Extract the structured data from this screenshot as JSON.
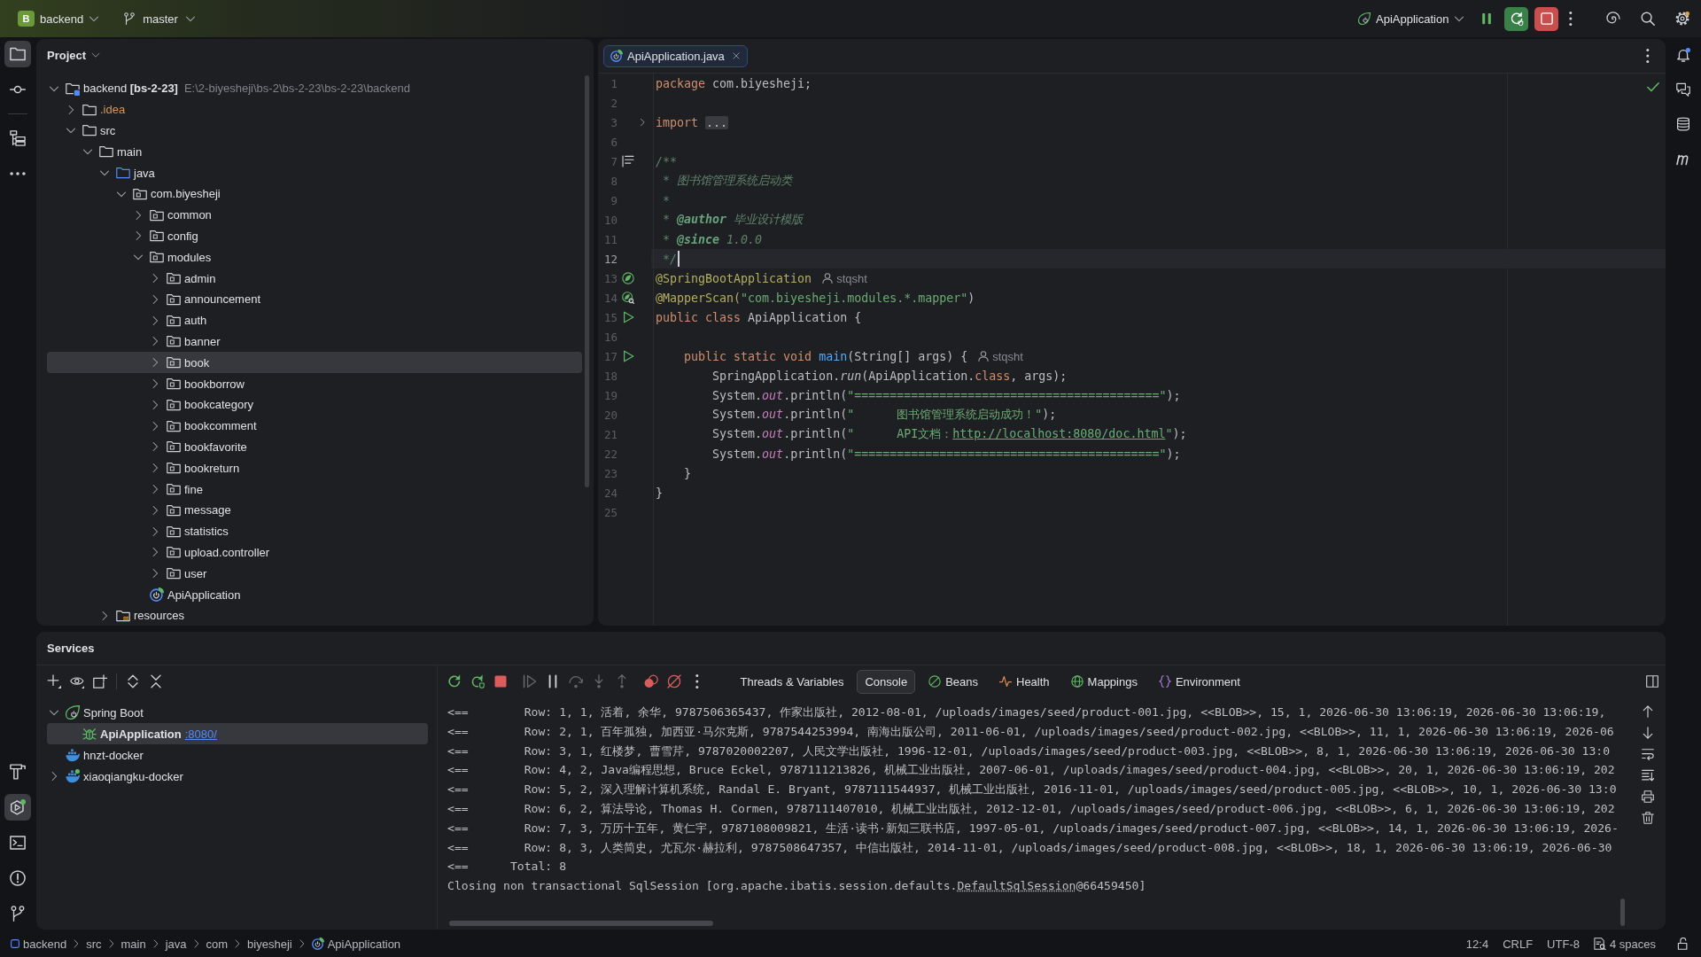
{
  "title_bar": {
    "project_badge": "B",
    "project": "backend",
    "branch": "master",
    "run_config": "ApiApplication"
  },
  "left_stripe": {
    "top": [
      {
        "kind": "project",
        "selected": true
      },
      {
        "kind": "commit",
        "selected": false
      },
      {
        "kind": "structure",
        "selected": false
      },
      {
        "kind": "more",
        "selected": false
      }
    ],
    "bottom": [
      {
        "kind": "build",
        "selected": false
      },
      {
        "kind": "services",
        "selected": true
      },
      {
        "kind": "terminal",
        "selected": false
      },
      {
        "kind": "problems",
        "selected": false
      },
      {
        "kind": "git",
        "selected": false
      }
    ]
  },
  "project": {
    "title": "Project",
    "tree": [
      {
        "label": "backend **[bs-2-23]**",
        "location": "E:\\2-biyesheji\\bs-2\\bs-2-23\\bs-2-23\\backend",
        "kind": "module",
        "expanded": true,
        "selected": false,
        "children": [
          {
            "label": ".idea",
            "kind": "ignored",
            "expanded": false,
            "selected": false
          },
          {
            "label": "src",
            "kind": "folder",
            "expanded": true,
            "selected": false,
            "children": [
              {
                "label": "main",
                "kind": "folder",
                "expanded": true,
                "selected": false,
                "children": [
                  {
                    "label": "java",
                    "kind": "sources",
                    "expanded": true,
                    "selected": false,
                    "children": [
                      {
                        "label": "com.biyesheji",
                        "kind": "package",
                        "expanded": true,
                        "selected": false,
                        "children": [
                          {
                            "label": "common",
                            "kind": "package",
                            "expanded": false,
                            "selected": false
                          },
                          {
                            "label": "config",
                            "kind": "package",
                            "expanded": false,
                            "selected": false
                          },
                          {
                            "label": "modules",
                            "kind": "package",
                            "expanded": true,
                            "selected": false,
                            "children": [
                              {
                                "label": "admin",
                                "kind": "package",
                                "expanded": false,
                                "selected": false
                              },
                              {
                                "label": "announcement",
                                "kind": "package",
                                "expanded": false,
                                "selected": false
                              },
                              {
                                "label": "auth",
                                "kind": "package",
                                "expanded": false,
                                "selected": false
                              },
                              {
                                "label": "banner",
                                "kind": "package",
                                "expanded": false,
                                "selected": false
                              },
                              {
                                "label": "book",
                                "kind": "package",
                                "expanded": false,
                                "selected": true
                              },
                              {
                                "label": "bookborrow",
                                "kind": "package",
                                "expanded": false,
                                "selected": false
                              },
                              {
                                "label": "bookcategory",
                                "kind": "package",
                                "expanded": false,
                                "selected": false
                              },
                              {
                                "label": "bookcomment",
                                "kind": "package",
                                "expanded": false,
                                "selected": false
                              },
                              {
                                "label": "bookfavorite",
                                "kind": "package",
                                "expanded": false,
                                "selected": false
                              },
                              {
                                "label": "bookreturn",
                                "kind": "package",
                                "expanded": false,
                                "selected": false
                              },
                              {
                                "label": "fine",
                                "kind": "package",
                                "expanded": false,
                                "selected": false
                              },
                              {
                                "label": "message",
                                "kind": "package",
                                "expanded": false,
                                "selected": false
                              },
                              {
                                "label": "statistics",
                                "kind": "package",
                                "expanded": false,
                                "selected": false
                              },
                              {
                                "label": "upload.controller",
                                "kind": "package",
                                "expanded": false,
                                "selected": false
                              },
                              {
                                "label": "user",
                                "kind": "package",
                                "expanded": false,
                                "selected": false
                              }
                            ]
                          },
                          {
                            "label": "ApiApplication",
                            "kind": "class",
                            "selected": false
                          }
                        ]
                      }
                    ]
                  },
                  {
                    "label": "resources",
                    "kind": "resources",
                    "expanded": false,
                    "selected": false
                  }
                ]
              }
            ]
          }
        ]
      }
    ]
  },
  "editor": {
    "tabs": [
      {
        "label": "ApiApplication.java",
        "selected": true
      }
    ],
    "lines": [
      {
        "number": "1",
        "current": false,
        "tokens": [
          {
            "kind": "keyword",
            "text": "package"
          },
          {
            "kind": "plain",
            "text": " com.biyesheji;"
          }
        ]
      },
      {
        "number": "2",
        "current": false
      },
      {
        "number": "3",
        "current": false,
        "gutter": {
          "kind": "fold"
        },
        "tokens": [
          {
            "kind": "keyword",
            "text": "import "
          },
          {
            "kind": "folded",
            "text": "..."
          }
        ]
      },
      {
        "number": "6",
        "current": false
      },
      {
        "number": "7",
        "current": false,
        "gutter": {
          "kind": "doc"
        },
        "tokens": [
          {
            "kind": "doc",
            "text": "/**"
          }
        ]
      },
      {
        "number": "8",
        "current": false,
        "tokens": [
          {
            "kind": "doc",
            "text": " * 图书馆管理系统启动类"
          }
        ]
      },
      {
        "number": "9",
        "current": false,
        "tokens": [
          {
            "kind": "doc",
            "text": " *"
          }
        ]
      },
      {
        "number": "10",
        "current": false,
        "tokens": [
          {
            "kind": "doc",
            "text": " * "
          },
          {
            "kind": "doctag",
            "text": "@author"
          },
          {
            "kind": "doc",
            "text": " 毕业设计模版"
          }
        ]
      },
      {
        "number": "11",
        "current": false,
        "tokens": [
          {
            "kind": "doc",
            "text": " * "
          },
          {
            "kind": "doctag",
            "text": "@since"
          },
          {
            "kind": "doc",
            "text": " 1.0.0"
          }
        ]
      },
      {
        "number": "12",
        "current": true,
        "tokens": [
          {
            "kind": "doc",
            "text": " */"
          }
        ]
      },
      {
        "number": "13",
        "current": false,
        "gutter": {
          "kind": "bean"
        },
        "author": "stqsht",
        "tokens": [
          {
            "kind": "annotation",
            "text": "@SpringBootApplication"
          }
        ]
      },
      {
        "number": "14",
        "current": false,
        "gutter": {
          "kind": "mapper"
        },
        "tokens": [
          {
            "kind": "annotation",
            "text": "@MapperScan("
          },
          {
            "kind": "string",
            "text": "\"com.biyesheji.modules.*.mapper\""
          },
          {
            "kind": "plain",
            "text": ")"
          }
        ]
      },
      {
        "number": "15",
        "current": false,
        "gutter": {
          "kind": "run"
        },
        "tokens": [
          {
            "kind": "keyword",
            "text": "public class"
          },
          {
            "kind": "plain",
            "text": " ApiApplication {"
          }
        ]
      },
      {
        "number": "16",
        "current": false
      },
      {
        "number": "17",
        "current": false,
        "gutter": {
          "kind": "run"
        },
        "author": "stqsht",
        "tokens": [
          {
            "kind": "keyword",
            "text": "    public static void "
          },
          {
            "kind": "method",
            "text": "main"
          },
          {
            "kind": "plain",
            "text": "(String[] args) {"
          }
        ]
      },
      {
        "number": "18",
        "current": false,
        "tokens": [
          {
            "kind": "plain",
            "text": "        SpringApplication."
          },
          {
            "kind": "static-call",
            "text": "run"
          },
          {
            "kind": "plain",
            "text": "(ApiApplication."
          },
          {
            "kind": "keyword",
            "text": "class"
          },
          {
            "kind": "plain",
            "text": ", args);"
          }
        ]
      },
      {
        "number": "19",
        "current": false,
        "tokens": [
          {
            "kind": "plain",
            "text": "        System."
          },
          {
            "kind": "static-field",
            "text": "out"
          },
          {
            "kind": "plain",
            "text": ".println("
          },
          {
            "kind": "string",
            "text": "\"===========================================\""
          },
          {
            "kind": "plain",
            "text": ");"
          }
        ]
      },
      {
        "number": "20",
        "current": false,
        "tokens": [
          {
            "kind": "plain",
            "text": "        System."
          },
          {
            "kind": "static-field",
            "text": "out"
          },
          {
            "kind": "plain",
            "text": ".println("
          },
          {
            "kind": "string",
            "text": "\"      图书馆管理系统启动成功！\""
          },
          {
            "kind": "plain",
            "text": ");"
          }
        ]
      },
      {
        "number": "21",
        "current": false,
        "tokens": [
          {
            "kind": "plain",
            "text": "        System."
          },
          {
            "kind": "static-field",
            "text": "out"
          },
          {
            "kind": "plain",
            "text": ".println("
          },
          {
            "kind": "string",
            "text": "\"      API文档："
          },
          {
            "kind": "link",
            "text": "http://localhost:8080/doc.html"
          },
          {
            "kind": "string",
            "text": "\""
          },
          {
            "kind": "plain",
            "text": ");"
          }
        ]
      },
      {
        "number": "22",
        "current": false,
        "tokens": [
          {
            "kind": "plain",
            "text": "        System."
          },
          {
            "kind": "static-field",
            "text": "out"
          },
          {
            "kind": "plain",
            "text": ".println("
          },
          {
            "kind": "string",
            "text": "\"===========================================\""
          },
          {
            "kind": "plain",
            "text": ");"
          }
        ]
      },
      {
        "number": "23",
        "current": false,
        "tokens": [
          {
            "kind": "plain",
            "text": "    }"
          }
        ]
      },
      {
        "number": "24",
        "current": false,
        "tokens": [
          {
            "kind": "plain",
            "text": "}"
          }
        ]
      },
      {
        "number": "25",
        "current": false
      }
    ]
  },
  "services": {
    "title": "Services",
    "tree": [
      {
        "label": "Spring Boot",
        "kind": "spring",
        "expanded": true,
        "selected": false,
        "running": false,
        "children": [
          {
            "label": "ApiApplication",
            "kind": "debug",
            "link": ":8080/",
            "selected": true,
            "running": false
          }
        ]
      },
      {
        "label": "hnzt-docker",
        "kind": "docker",
        "selected": false,
        "running": false
      },
      {
        "label": "xiaoqiangku-docker",
        "kind": "docker",
        "expanded": false,
        "selected": false,
        "running": true
      }
    ],
    "debug_toolbar": [
      {
        "kind": "rerun",
        "disabled": false
      },
      {
        "kind": "rerun-debug",
        "disabled": false
      },
      {
        "kind": "stop",
        "disabled": false
      },
      {
        "kind": "resume",
        "disabled": true
      },
      {
        "kind": "pause",
        "disabled": false
      },
      {
        "kind": "step-over",
        "disabled": true
      },
      {
        "kind": "step-into",
        "disabled": true
      },
      {
        "kind": "step-out",
        "disabled": true
      },
      {
        "kind": "breakpoints",
        "disabled": false
      },
      {
        "kind": "mute-breakpoints",
        "disabled": false
      },
      {
        "kind": "more",
        "disabled": false
      }
    ],
    "tabs": [
      {
        "label": "Threads & Variables",
        "kind": "text",
        "selected": false
      },
      {
        "label": "Console",
        "kind": "text",
        "selected": true
      },
      {
        "label": "Beans",
        "kind": "beans",
        "selected": false
      },
      {
        "label": "Health",
        "kind": "health",
        "selected": false
      },
      {
        "label": "Mappings",
        "kind": "mappings",
        "selected": false
      },
      {
        "label": "Environment",
        "kind": "environment",
        "selected": false
      }
    ],
    "console": [
      {
        "text": "<==        Row: 1, 1, 活着, 余华, 9787506365437, 作家出版社, 2012-08-01, /uploads/images/seed/product-001.jpg, <<BLOB>>, 15, 1, 2026-06-30 13:06:19, 2026-06-30 13:06:19,"
      },
      {
        "text": "<==        Row: 2, 1, 百年孤独, 加西亚·马尔克斯, 9787544253994, 南海出版公司, 2011-06-01, /uploads/images/seed/product-002.jpg, <<BLOB>>, 11, 1, 2026-06-30 13:06:19, 2026-06"
      },
      {
        "text": "<==        Row: 3, 1, 红楼梦, 曹雪芹, 9787020002207, 人民文学出版社, 1996-12-01, /uploads/images/seed/product-003.jpg, <<BLOB>>, 8, 1, 2026-06-30 13:06:19, 2026-06-30 13:0"
      },
      {
        "text": "<==        Row: 4, 2, Java编程思想, Bruce Eckel, 9787111213826, 机械工业出版社, 2007-06-01, /uploads/images/seed/product-004.jpg, <<BLOB>>, 20, 1, 2026-06-30 13:06:19, 202"
      },
      {
        "text": "<==        Row: 5, 2, 深入理解计算机系统, Randal E. Bryant, 9787111544937, 机械工业出版社, 2016-11-01, /uploads/images/seed/product-005.jpg, <<BLOB>>, 10, 1, 2026-06-30 13:0"
      },
      {
        "text": "<==        Row: 6, 2, 算法导论, Thomas H. Cormen, 9787111407010, 机械工业出版社, 2012-12-01, /uploads/images/seed/product-006.jpg, <<BLOB>>, 6, 1, 2026-06-30 13:06:19, 202"
      },
      {
        "text": "<==        Row: 7, 3, 万历十五年, 黄仁宇, 9787108009821, 生活·读书·新知三联书店, 1997-05-01, /uploads/images/seed/product-007.jpg, <<BLOB>>, 14, 1, 2026-06-30 13:06:19, 2026-"
      },
      {
        "text": "<==        Row: 8, 3, 人类简史, 尤瓦尔·赫拉利, 9787508647357, 中信出版社, 2014-11-01, /uploads/images/seed/product-008.jpg, <<BLOB>>, 18, 1, 2026-06-30 13:06:19, 2026-06-30"
      },
      {
        "text": "<==      Total: 8"
      },
      {
        "text": "Closing non transactional SqlSession [org.apache.ibatis.session.defaults.",
        "link": "DefaultSqlSession",
        "after": "@66459450]"
      }
    ]
  },
  "status_bar": {
    "breadcrumbs": [
      {
        "label": "backend",
        "kind": "module"
      },
      {
        "label": "src",
        "kind": "folder"
      },
      {
        "label": "main",
        "kind": "folder"
      },
      {
        "label": "java",
        "kind": "folder"
      },
      {
        "label": "com",
        "kind": "folder"
      },
      {
        "label": "biyesheji",
        "kind": "folder"
      },
      {
        "label": "ApiApplication",
        "kind": "class"
      }
    ],
    "items": [
      {
        "label": "12:4",
        "kind": "text"
      },
      {
        "label": "CRLF",
        "kind": "text"
      },
      {
        "label": "UTF-8",
        "kind": "text"
      },
      {
        "label": "4 spaces",
        "kind": "indent"
      }
    ]
  }
}
